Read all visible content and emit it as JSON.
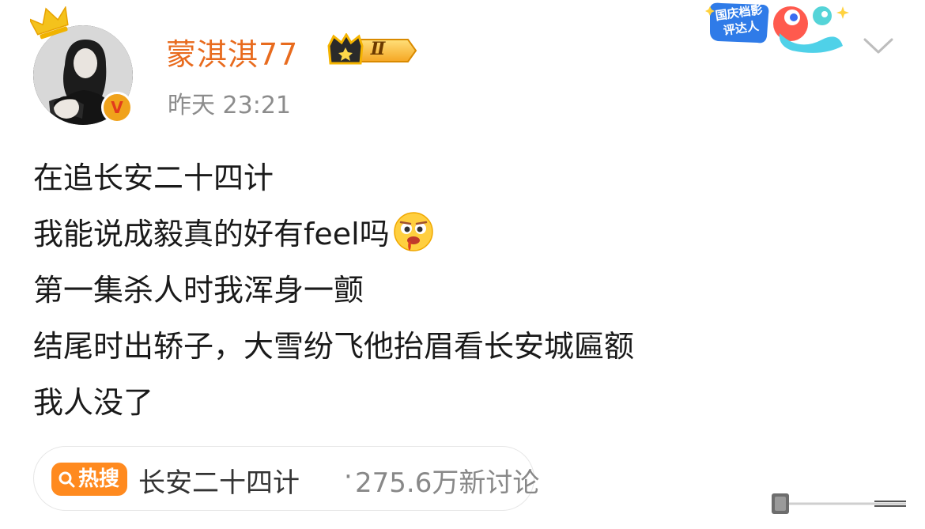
{
  "post": {
    "author": {
      "name": "蒙淇淇77",
      "vip_level": "Ⅱ"
    },
    "timestamp": "昨天 23:21",
    "promo_badge": "国庆档影评达人",
    "content_lines": [
      "在追长安二十四计",
      "我能说成毅真的好有feel吗",
      "第一集杀人时我浑身一颤",
      "结尾时出轿子，大雪纷飞他抬眉看长安城匾额",
      "我人没了"
    ],
    "emoji": "drooling-face-icon",
    "hot_topic": {
      "badge": "热搜",
      "name": "长安二十四计",
      "separator": "·",
      "count": "275.6万新讨论"
    }
  },
  "icons": {
    "crown": "crown-icon",
    "verified": "verified-icon",
    "menu": "chevron-down-icon",
    "hot_badge": "search-icon"
  },
  "colors": {
    "username": "#e86b1e",
    "timestamp": "#8c8c8c",
    "hot_badge": "#ff8a1f",
    "verified": "#f0a21b"
  }
}
